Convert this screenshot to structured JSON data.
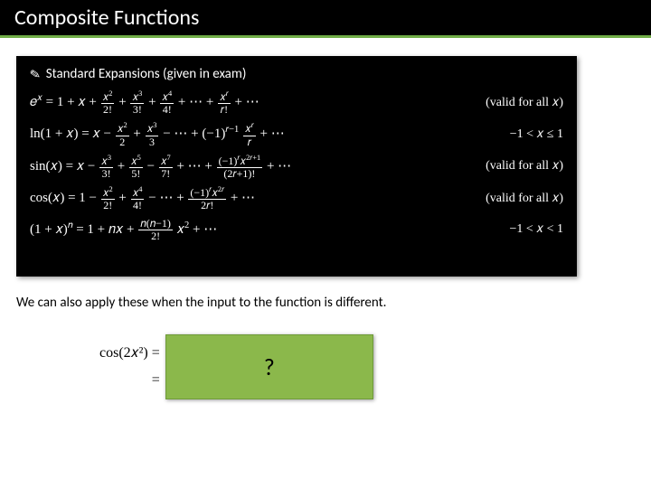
{
  "title": "Composite Functions",
  "expansions": {
    "header": "Standard Expansions (given in exam)",
    "rows": [
      {
        "id": "exp-ex",
        "validity": "(valid for all 𝑥)"
      },
      {
        "id": "exp-ln",
        "validity": "−1 < 𝑥 ≤ 1"
      },
      {
        "id": "exp-sin",
        "validity": "(valid for all 𝑥)"
      },
      {
        "id": "exp-cos",
        "validity": "(valid for all 𝑥)"
      },
      {
        "id": "exp-binom",
        "validity": "−1 < 𝑥 < 1"
      }
    ]
  },
  "body_text": "We can also apply these when the input to the function is different.",
  "example": {
    "lhs_line1": "cos(2𝑥²) =",
    "lhs_line2": "=",
    "answer_placeholder": "?"
  },
  "chart_data": {
    "type": "table",
    "title": "Standard Maclaurin expansions",
    "series": [
      {
        "name": "e^x",
        "expansion": "1 + x + x^2/2! + x^3/3! + x^4/4! + ... + x^r/r! + ...",
        "validity": "all x"
      },
      {
        "name": "ln(1+x)",
        "expansion": "x - x^2/2 + x^3/3 - ... + (-1)^{r-1} x^r / r + ...",
        "validity": "-1 < x <= 1"
      },
      {
        "name": "sin(x)",
        "expansion": "x - x^3/3! + x^5/5! - x^7/7! + ... + (-1)^r x^{2r+1}/(2r+1)! + ...",
        "validity": "all x"
      },
      {
        "name": "cos(x)",
        "expansion": "1 - x^2/2! + x^4/4! - ... + (-1)^r x^{2r}/(2r)! + ...",
        "validity": "all x"
      },
      {
        "name": "(1+x)^n",
        "expansion": "1 + n x + n(n-1)/2! x^2 + ...",
        "validity": "-1 < x < 1"
      }
    ]
  }
}
